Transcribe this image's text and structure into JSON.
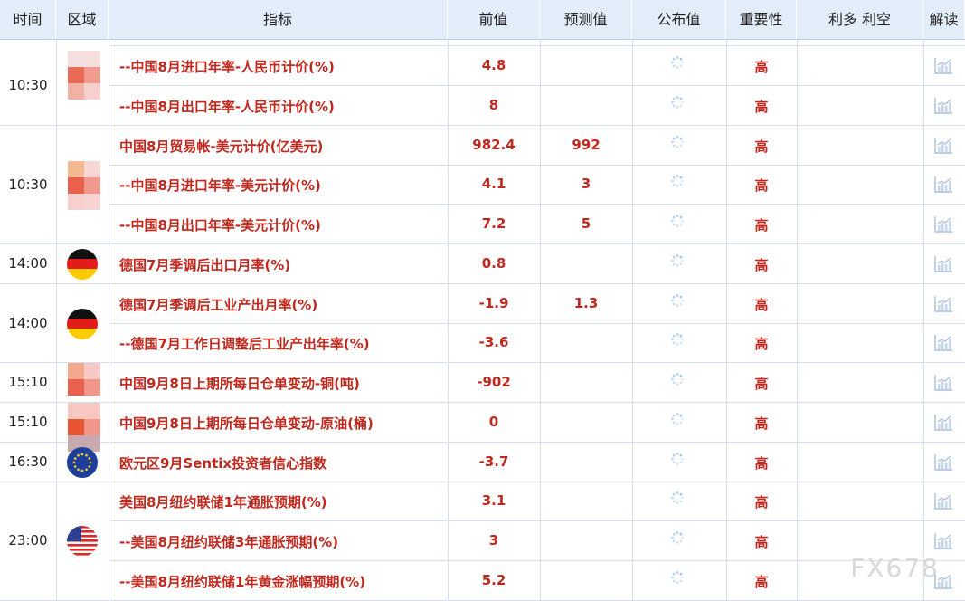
{
  "header": {
    "time": "时间",
    "region": "区域",
    "indicator": "指标",
    "previous": "前值",
    "forecast": "预测值",
    "actual": "公布值",
    "importance": "重要性",
    "bullbear": "利多 利空",
    "analysis": "解读"
  },
  "groups": [
    {
      "time": "10:30",
      "region": "china-mosaic-a"
    },
    {
      "time": "10:30",
      "region": "china-mosaic-b"
    },
    {
      "time": "14:00",
      "region": "germany-flag"
    },
    {
      "time": "14:00",
      "region": "germany-flag"
    },
    {
      "time": "15:10",
      "region": "china-mosaic-c"
    },
    {
      "time": "15:10",
      "region": "china-mosaic-d"
    },
    {
      "time": "16:30",
      "region": "eu-flag"
    },
    {
      "time": "23:00",
      "region": "usa-flag"
    }
  ],
  "rows": [
    {
      "indicator": "--中国8月进口年率-人民币计价(%)",
      "previous": "4.8",
      "forecast": "",
      "importance": "高"
    },
    {
      "indicator": "--中国8月出口年率-人民币计价(%)",
      "previous": "8",
      "forecast": "",
      "importance": "高"
    },
    {
      "indicator": "中国8月贸易帐-美元计价(亿美元)",
      "previous": "982.4",
      "forecast": "992",
      "importance": "高"
    },
    {
      "indicator": "--中国8月进口年率-美元计价(%)",
      "previous": "4.1",
      "forecast": "3",
      "importance": "高"
    },
    {
      "indicator": "--中国8月出口年率-美元计价(%)",
      "previous": "7.2",
      "forecast": "5",
      "importance": "高"
    },
    {
      "indicator": "德国7月季调后出口月率(%)",
      "previous": "0.8",
      "forecast": "",
      "importance": "高"
    },
    {
      "indicator": "德国7月季调后工业产出月率(%)",
      "previous": "-1.9",
      "forecast": "1.3",
      "importance": "高"
    },
    {
      "indicator": "--德国7月工作日调整后工业产出年率(%)",
      "previous": "-3.6",
      "forecast": "",
      "importance": "高"
    },
    {
      "indicator": "中国9月8日上期所每日仓单变动-铜(吨)",
      "previous": "-902",
      "forecast": "",
      "importance": "高"
    },
    {
      "indicator": "中国9月8日上期所每日仓单变动-原油(桶)",
      "previous": "0",
      "forecast": "",
      "importance": "高"
    },
    {
      "indicator": "欧元区9月Sentix投资者信心指数",
      "previous": "-3.7",
      "forecast": "",
      "importance": "高"
    },
    {
      "indicator": "美国8月纽约联储1年通胀预期(%)",
      "previous": "3.1",
      "forecast": "",
      "importance": "高"
    },
    {
      "indicator": "--美国8月纽约联储3年通胀预期(%)",
      "previous": "3",
      "forecast": "",
      "importance": "高"
    },
    {
      "indicator": "--美国8月纽约联储1年黄金涨幅预期(%)",
      "previous": "5.2",
      "forecast": "",
      "importance": "高"
    }
  ],
  "watermark": "FX678",
  "colors": {
    "header_bg": "#e3ecf9",
    "value_red": "#c0281e",
    "grid": "#d3def0"
  }
}
